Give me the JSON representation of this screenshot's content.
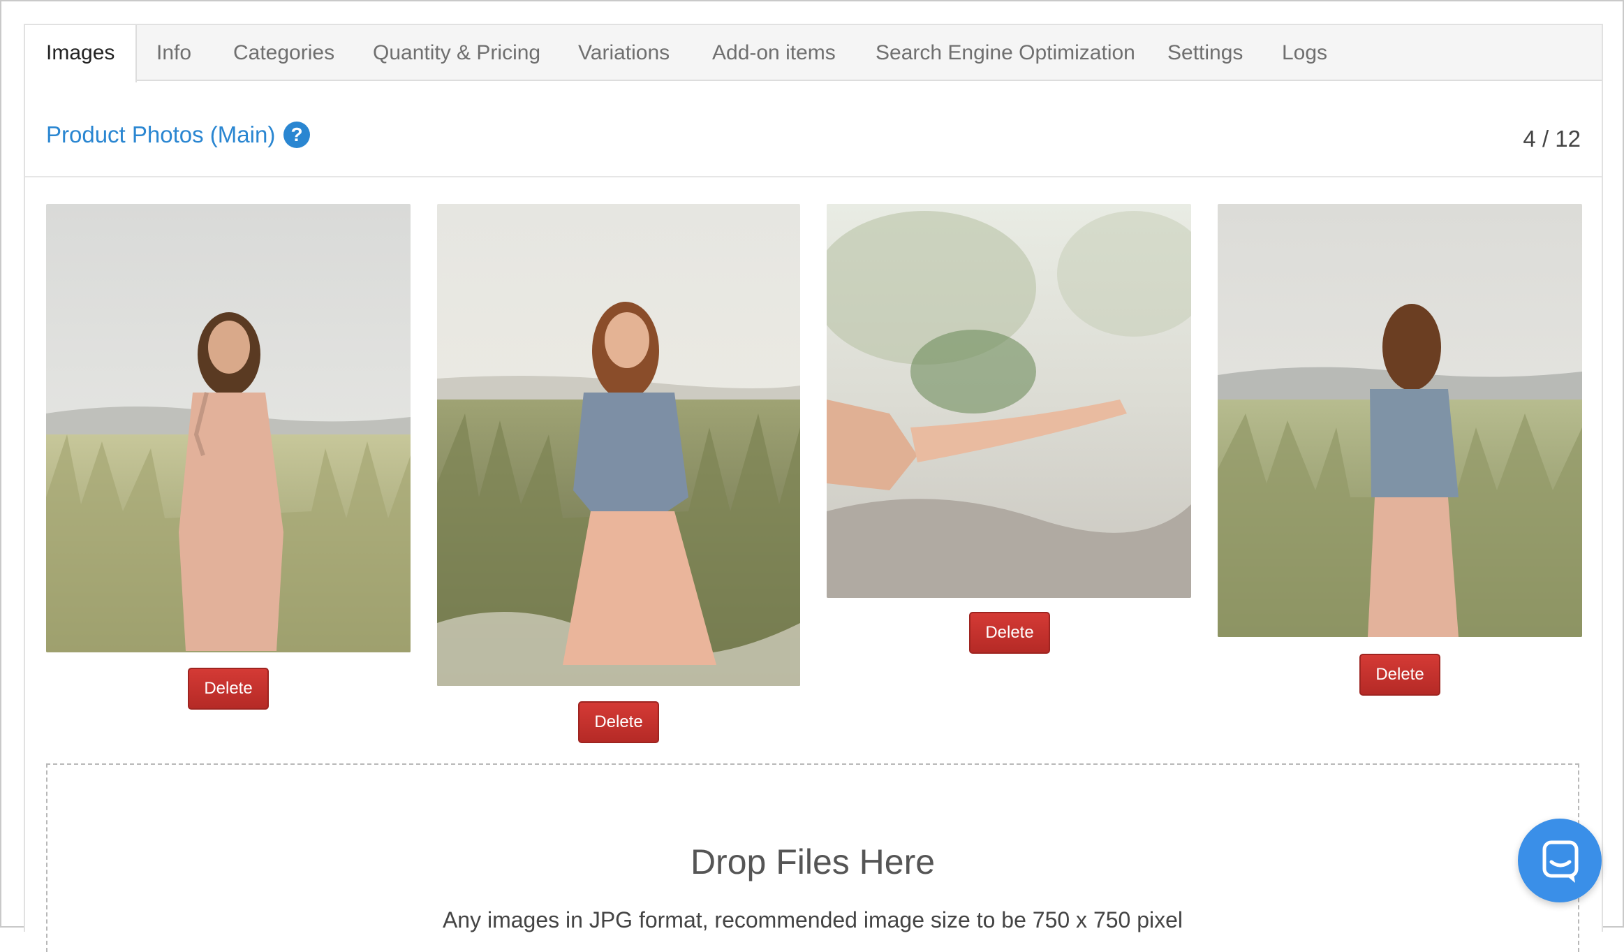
{
  "tabs": [
    {
      "label": "Images",
      "active": true
    },
    {
      "label": "Info"
    },
    {
      "label": "Categories"
    },
    {
      "label": "Quantity & Pricing"
    },
    {
      "label": "Variations"
    },
    {
      "label": "Add-on items"
    },
    {
      "label": "Search Engine Optimization"
    },
    {
      "label": "Settings"
    },
    {
      "label": "Logs"
    }
  ],
  "section": {
    "title": "Product Photos (Main)",
    "help_icon": "?",
    "counter": "4 / 12"
  },
  "photos": [
    {
      "delete_label": "Delete"
    },
    {
      "delete_label": "Delete"
    },
    {
      "delete_label": "Delete"
    },
    {
      "delete_label": "Delete"
    }
  ],
  "dropzone": {
    "title": "Drop Files Here",
    "subtitle": "Any images in JPG format, recommended image size to be 750 x 750 pixel"
  },
  "colors": {
    "accent": "#2a86d1",
    "delete": "#c0312d",
    "chat": "#3a8fe8"
  },
  "icons": {
    "help": "question-circle-icon",
    "chat": "chat-bubble-icon"
  }
}
